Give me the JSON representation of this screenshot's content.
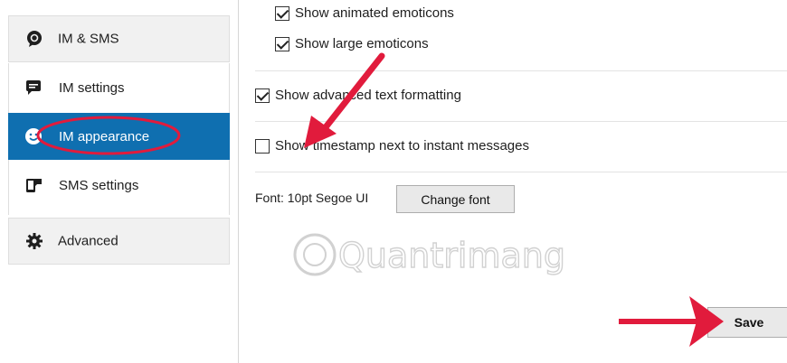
{
  "sidebar": {
    "im_sms_label": "IM & SMS",
    "items": [
      {
        "label": "IM settings",
        "icon": "chat-bubble-icon"
      },
      {
        "label": "IM appearance",
        "icon": "smiley-icon",
        "active": true
      },
      {
        "label": "SMS settings",
        "icon": "phone-sms-icon"
      }
    ],
    "advanced_label": "Advanced"
  },
  "main": {
    "options": [
      {
        "label": "Show animated emoticons",
        "checked": true
      },
      {
        "label": "Show large emoticons",
        "checked": true
      },
      {
        "label": "Show advanced text formatting",
        "checked": true
      },
      {
        "label": "Show timestamp next to instant messages",
        "checked": false
      }
    ],
    "font_label": "Font: 10pt Segoe UI",
    "change_font_label": "Change font",
    "save_label": "Save"
  },
  "watermark_text": "Quantrimang",
  "colors": {
    "accent": "#0f6fb0",
    "annotation": "#e11b3c"
  }
}
